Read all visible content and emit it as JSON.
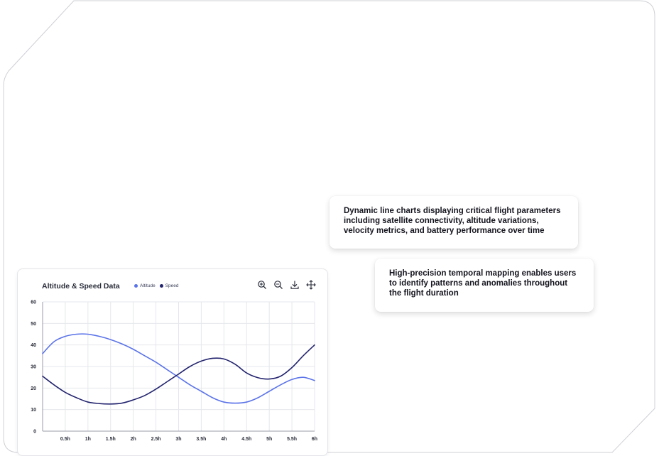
{
  "callouts": [
    "Dynamic line charts displaying critical flight parameters including satellite connectivity, altitude variations, velocity metrics, and battery performance over time",
    "High-precision temporal mapping enables users to identify patterns and anomalies throughout the flight duration"
  ],
  "toolbar": {
    "zoom_in_icon": "zoom-in-icon",
    "zoom_out_icon": "zoom-out-icon",
    "download_icon": "download-icon",
    "pan_icon": "pan-icon"
  },
  "chart_data": {
    "type": "line",
    "title": "Altitude & Speed Data",
    "xlabel": "",
    "ylabel": "",
    "x": [
      0,
      0.25,
      0.5,
      0.75,
      1,
      1.25,
      1.5,
      1.75,
      2,
      2.25,
      2.5,
      2.75,
      3,
      3.25,
      3.5,
      3.75,
      4,
      4.25,
      4.5,
      4.75,
      5,
      5.25,
      5.5,
      5.75,
      6
    ],
    "x_tick_labels": [
      "0.5h",
      "1h",
      "1.5h",
      "2h",
      "2.5h",
      "3h",
      "3.5h",
      "4h",
      "4.5h",
      "5h",
      "5.5h",
      "6h"
    ],
    "x_tick_values": [
      0.5,
      1,
      1.5,
      2,
      2.5,
      3,
      3.5,
      4,
      4.5,
      5,
      5.5,
      6
    ],
    "xlim": [
      0,
      6
    ],
    "ylim": [
      0,
      60
    ],
    "y_ticks": [
      0,
      10,
      20,
      30,
      40,
      50,
      60
    ],
    "grid": true,
    "legend_position": "top",
    "series": [
      {
        "name": "Altitude",
        "color": "#5b73e8",
        "values": [
          36,
          41.5,
          44,
          45,
          45,
          44,
          42.5,
          40.5,
          38,
          35,
          32,
          28.5,
          25,
          21.5,
          18.5,
          15.5,
          13.5,
          13,
          13.5,
          15.5,
          18.5,
          21.5,
          24,
          25,
          23.5
        ]
      },
      {
        "name": "Speed",
        "color": "#23246e",
        "values": [
          25.5,
          21.5,
          18,
          15.5,
          13.5,
          12.8,
          12.6,
          13,
          14.5,
          16.5,
          19.5,
          23,
          26.5,
          30,
          32.5,
          33.8,
          33.5,
          31,
          27,
          24.8,
          24.2,
          25.5,
          29.5,
          35,
          40
        ]
      }
    ]
  }
}
